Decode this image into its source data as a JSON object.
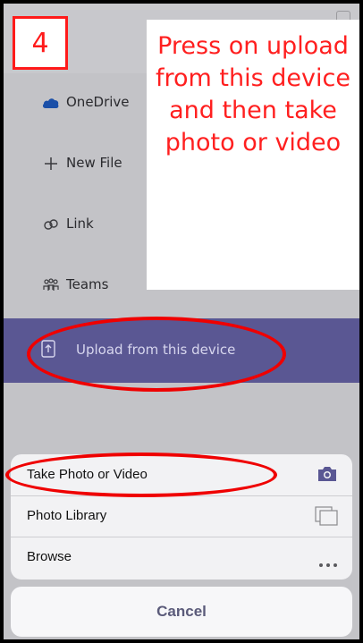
{
  "step_number": "4",
  "callout": "Press on upload from this device and then take photo or video",
  "menu": {
    "items": [
      {
        "label": "OneDrive",
        "icon": "onedrive-icon"
      },
      {
        "label": "New File",
        "icon": "plus-icon"
      },
      {
        "label": "Link",
        "icon": "link-icon"
      },
      {
        "label": "Teams",
        "icon": "teams-icon"
      }
    ],
    "upload_label": "Upload from this device"
  },
  "sheet": {
    "items": [
      {
        "label": "Take Photo or Video",
        "icon": "camera-icon"
      },
      {
        "label": "Photo Library",
        "icon": "photo-library-icon"
      },
      {
        "label": "Browse",
        "icon": "more-icon"
      }
    ],
    "cancel_label": "Cancel"
  },
  "colors": {
    "annotation": "#ff1a1a",
    "upload_bg": "#5a5793"
  }
}
